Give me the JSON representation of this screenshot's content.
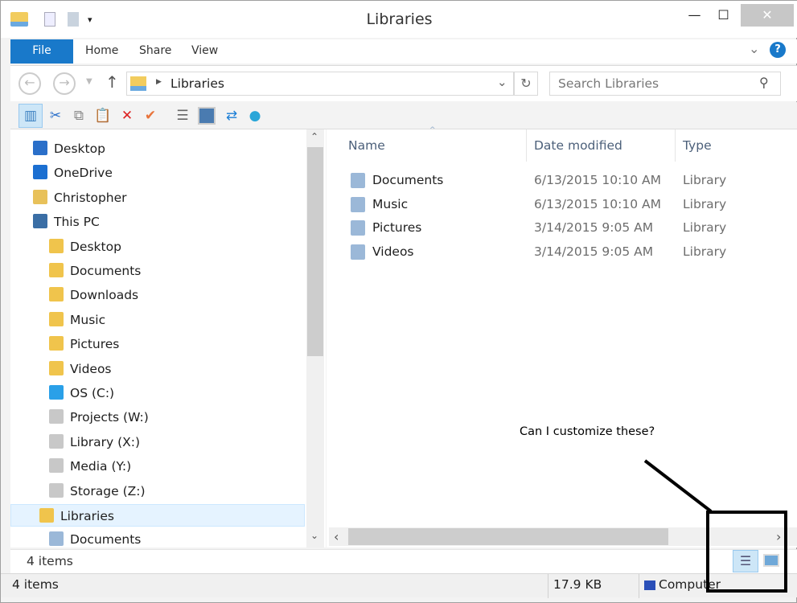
{
  "window": {
    "title": "Libraries"
  },
  "ribbon": {
    "tabs": [
      "File",
      "Home",
      "Share",
      "View"
    ]
  },
  "address": {
    "path": "Libraries",
    "search_placeholder": "Search Libraries"
  },
  "nav": {
    "items": [
      {
        "label": "Desktop",
        "level": 0,
        "icon": "desktop-icon",
        "color": "#2a6fc9"
      },
      {
        "label": "OneDrive",
        "level": 0,
        "icon": "cloud-icon",
        "color": "#1b6fd1"
      },
      {
        "label": "Christopher",
        "level": 0,
        "icon": "user-folder-icon",
        "color": "#e8c15a"
      },
      {
        "label": "This PC",
        "level": 0,
        "icon": "computer-icon",
        "color": "#3a6ea5"
      },
      {
        "label": "Desktop",
        "level": 1,
        "icon": "folder-icon",
        "color": "#f0c44c"
      },
      {
        "label": "Documents",
        "level": 1,
        "icon": "folder-icon",
        "color": "#f0c44c"
      },
      {
        "label": "Downloads",
        "level": 1,
        "icon": "folder-icon",
        "color": "#f0c44c"
      },
      {
        "label": "Music",
        "level": 1,
        "icon": "folder-icon",
        "color": "#f0c44c"
      },
      {
        "label": "Pictures",
        "level": 1,
        "icon": "folder-icon",
        "color": "#f0c44c"
      },
      {
        "label": "Videos",
        "level": 1,
        "icon": "folder-icon",
        "color": "#f0c44c"
      },
      {
        "label": "OS (C:)",
        "level": 1,
        "icon": "drive-icon",
        "color": "#2aa0e8"
      },
      {
        "label": "Projects (W:)",
        "level": 1,
        "icon": "network-drive-disconnected-icon",
        "color": "#c8c8c8"
      },
      {
        "label": "Library (X:)",
        "level": 1,
        "icon": "network-drive-disconnected-icon",
        "color": "#c8c8c8"
      },
      {
        "label": "Media (Y:)",
        "level": 1,
        "icon": "network-drive-disconnected-icon",
        "color": "#c8c8c8"
      },
      {
        "label": "Storage (Z:)",
        "level": 1,
        "icon": "network-drive-disconnected-icon",
        "color": "#c8c8c8"
      },
      {
        "label": "Libraries",
        "level": 0,
        "icon": "libraries-icon",
        "color": "#f0c44c",
        "selected": true
      },
      {
        "label": "Documents",
        "level": 1,
        "icon": "document-library-icon",
        "color": "#9bb8d8"
      }
    ]
  },
  "columns": {
    "name": "Name",
    "date": "Date modified",
    "type": "Type"
  },
  "files": [
    {
      "name": "Documents",
      "date": "6/13/2015 10:10 AM",
      "type": "Library"
    },
    {
      "name": "Music",
      "date": "6/13/2015 10:10 AM",
      "type": "Library"
    },
    {
      "name": "Pictures",
      "date": "3/14/2015 9:05 AM",
      "type": "Library"
    },
    {
      "name": "Videos",
      "date": "3/14/2015 9:05 AM",
      "type": "Library"
    }
  ],
  "status": {
    "count": "4 items",
    "count2": "4 items",
    "size": "17.9 KB",
    "location": "Computer"
  },
  "annotation": {
    "text": "Can I customize these?"
  }
}
